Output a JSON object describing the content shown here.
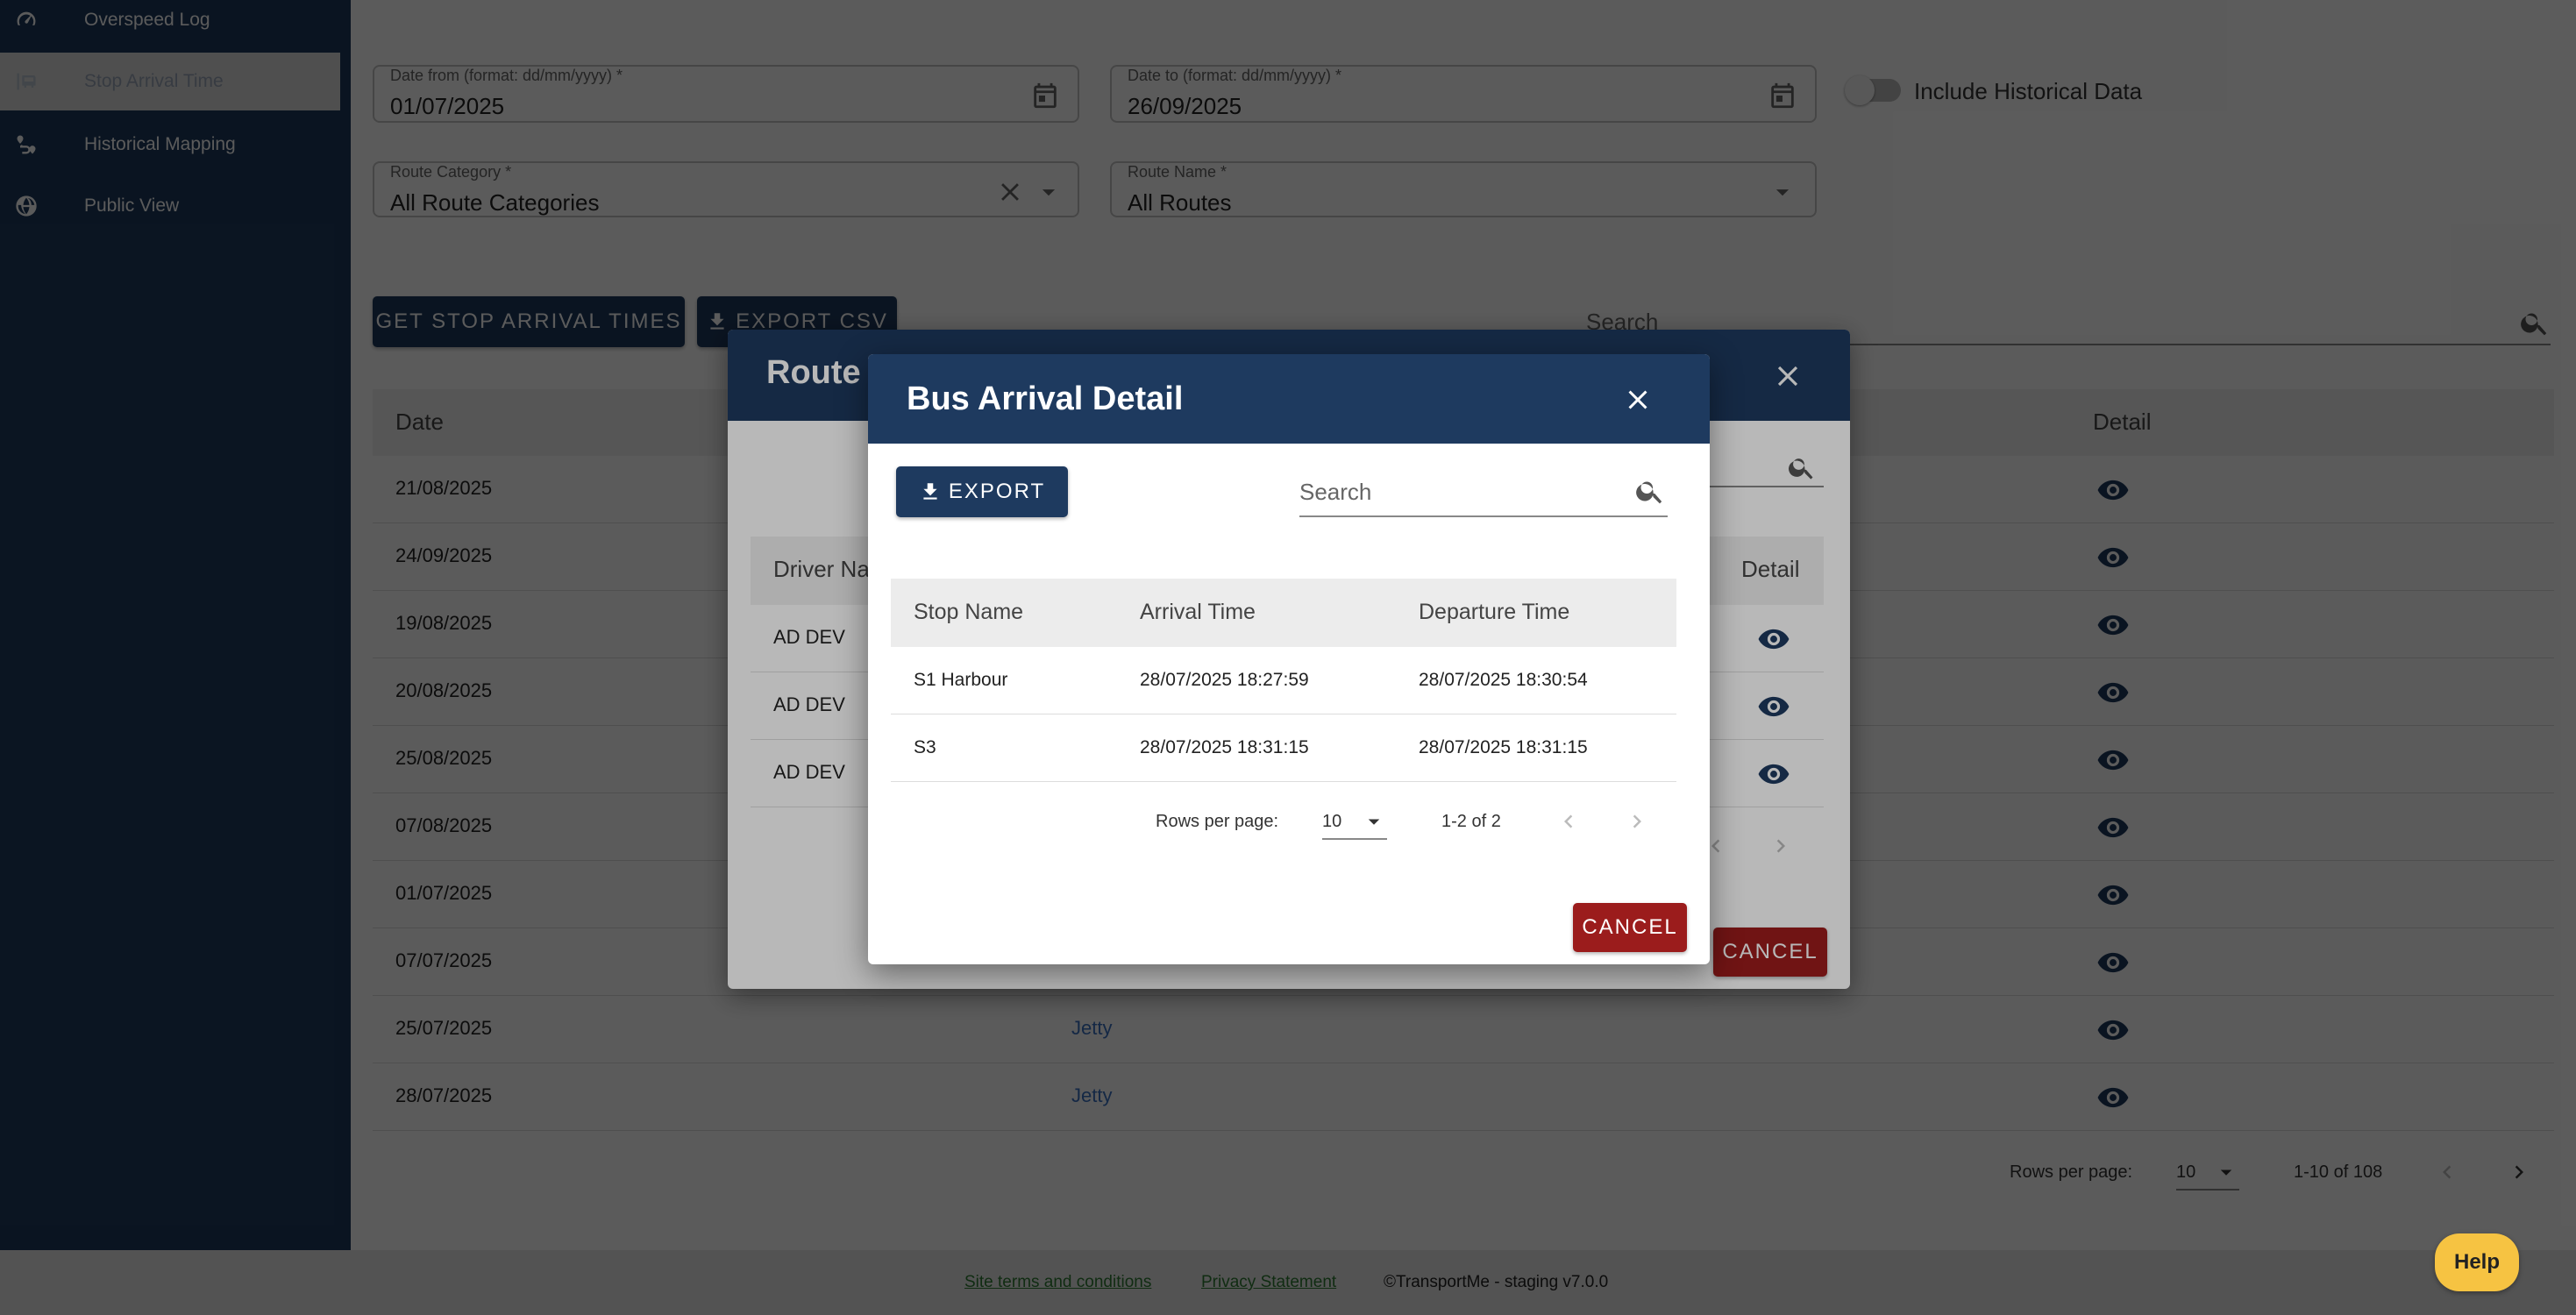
{
  "sidebar": {
    "items": [
      {
        "label": "Overspeed Log",
        "icon": "speed-icon"
      },
      {
        "label": "Stop Arrival Time",
        "icon": "bus-stop-icon"
      },
      {
        "label": "Historical Mapping",
        "icon": "route-map-icon"
      },
      {
        "label": "Public View",
        "icon": "globe-icon"
      }
    ]
  },
  "filters": {
    "date_from_label": "Date from (format: dd/mm/yyyy) *",
    "date_from_value": "01/07/2025",
    "date_to_label": "Date to (format: dd/mm/yyyy) *",
    "date_to_value": "26/09/2025",
    "include_historical_label": "Include Historical Data",
    "route_category_label": "Route Category *",
    "route_category_value": "All Route Categories",
    "route_name_label": "Route Name *",
    "route_name_value": "All Routes"
  },
  "toolbar": {
    "get_times_label": "GET STOP ARRIVAL TIMES",
    "export_csv_label": "EXPORT CSV",
    "search_placeholder": "Search"
  },
  "main_table": {
    "headers": {
      "date": "Date",
      "detail": "Detail"
    },
    "rows": [
      {
        "date": "21/08/2025",
        "route": ""
      },
      {
        "date": "24/09/2025",
        "route": ""
      },
      {
        "date": "19/08/2025",
        "route": ""
      },
      {
        "date": "20/08/2025",
        "route": ""
      },
      {
        "date": "25/08/2025",
        "route": ""
      },
      {
        "date": "07/08/2025",
        "route": ""
      },
      {
        "date": "01/07/2025",
        "route": ""
      },
      {
        "date": "07/07/2025",
        "route": ""
      },
      {
        "date": "25/07/2025",
        "route": "Jetty"
      },
      {
        "date": "28/07/2025",
        "route": "Jetty"
      }
    ],
    "pager": {
      "rows_label": "Rows per page:",
      "rows_value": "10",
      "range": "1-10 of 108"
    }
  },
  "route_dialog": {
    "title": "Route",
    "headers": {
      "driver": "Driver Na",
      "detail": "Detail"
    },
    "rows": [
      {
        "driver": "AD DEV"
      },
      {
        "driver": "AD DEV"
      },
      {
        "driver": "AD DEV"
      }
    ],
    "cancel_label": "CANCEL"
  },
  "arrival_dialog": {
    "title": "Bus Arrival Detail",
    "export_label": "EXPORT",
    "search_placeholder": "Search",
    "headers": {
      "stop": "Stop Name",
      "arrival": "Arrival Time",
      "departure": "Departure Time"
    },
    "rows": [
      {
        "stop": "S1 Harbour",
        "arrival": "28/07/2025 18:27:59",
        "departure": "28/07/2025 18:30:54"
      },
      {
        "stop": "S3",
        "arrival": "28/07/2025 18:31:15",
        "departure": "28/07/2025 18:31:15"
      }
    ],
    "pager": {
      "rows_label": "Rows per page:",
      "rows_value": "10",
      "range": "1-2 of 2"
    },
    "cancel_label": "CANCEL"
  },
  "footer": {
    "terms": "Site terms and conditions",
    "privacy": "Privacy Statement",
    "copyright": "©TransportMe - staging v7.0.0"
  },
  "help_label": "Help"
}
